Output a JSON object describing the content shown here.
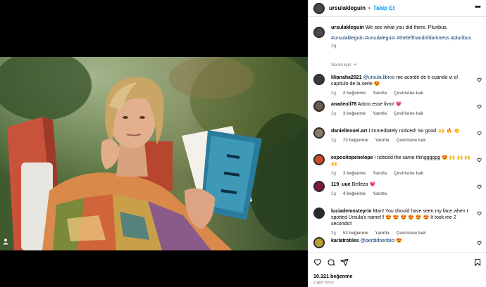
{
  "post": {
    "username": "ursulakleguin",
    "follow_label": "Takip Et",
    "caption_user": "ursulakleguin",
    "caption_text": "We see what you did there. Pluribus.",
    "hashtags": "#ursulakleguin #ursulaleguin #thelefthandofdarkness #pluribus",
    "caption_time": "2g",
    "sort_label": "Senin için"
  },
  "comments": [
    {
      "user": "lilianaha2021",
      "mention": "@ursula.libros",
      "text": " me acordé de ti cuando vi el capítulo de la serie 😍",
      "time": "2g",
      "likes": "2 beğenme",
      "reply": "Yanıtla",
      "translate": "Çevirisine bak",
      "avatar": "#3a3a3a"
    },
    {
      "user": "anadeoli78",
      "mention": "",
      "text": " Adoro esse livro! 💗",
      "time": "2g",
      "likes": "3 beğenme",
      "reply": "Yanıtla",
      "translate": "Çevirisine bak",
      "avatar": "#6a5a50"
    },
    {
      "user": "daniellenoel.art",
      "mention": "",
      "text": " I immediately noticed! So good. 🙌 🔥 👏",
      "time": "2g",
      "likes": "73 beğenme",
      "reply": "Yanıtla",
      "translate": "Çevirisine bak",
      "avatar": "#8a7a6a"
    },
    {
      "user": "expositopenelope",
      "mention": "",
      "text": " I noticed the same thingggggg 😍 🙌 🙌 🙌 🙌",
      "time": "2g",
      "likes": "3 beğenme",
      "reply": "Yanıtla",
      "translate": "Çevirisine bak",
      "avatar": "#c84a2a"
    },
    {
      "user": "119_uue",
      "mention": "",
      "text": " Belleza 💗",
      "time": "2g",
      "likes": "4 beğenme",
      "reply": "Yanıtla",
      "translate": "",
      "avatar": "#7a1a3a"
    },
    {
      "user": "luciademosteyrin",
      "mention": "",
      "text": " Man! You should have seen my face when I spotted Ursula's name!!! 😍 😍 😍 😍 😍 😍 It took me 2 seconds!!",
      "time": "2g",
      "likes": "53 beğenme",
      "reply": "Yanıtla",
      "translate": "Çevirisine bak",
      "avatar": "#2a2a2a"
    },
    {
      "user": "karlatrobles",
      "mention": "@perdidoenbici",
      "text": " 😍",
      "time": "",
      "likes": "",
      "reply": "",
      "translate": "",
      "avatar": "#b8a030"
    }
  ],
  "footer": {
    "likes": "10.321 beğenme",
    "time_ago": "2 gün önce"
  },
  "icons": {
    "more": "more-options-icon",
    "heart": "heart-icon",
    "comment": "comment-icon",
    "share": "share-icon",
    "bookmark": "bookmark-icon",
    "tag": "user-tag-icon"
  },
  "colors": {
    "accent": "#0095f6",
    "link": "#00376b",
    "muted": "#737373"
  }
}
